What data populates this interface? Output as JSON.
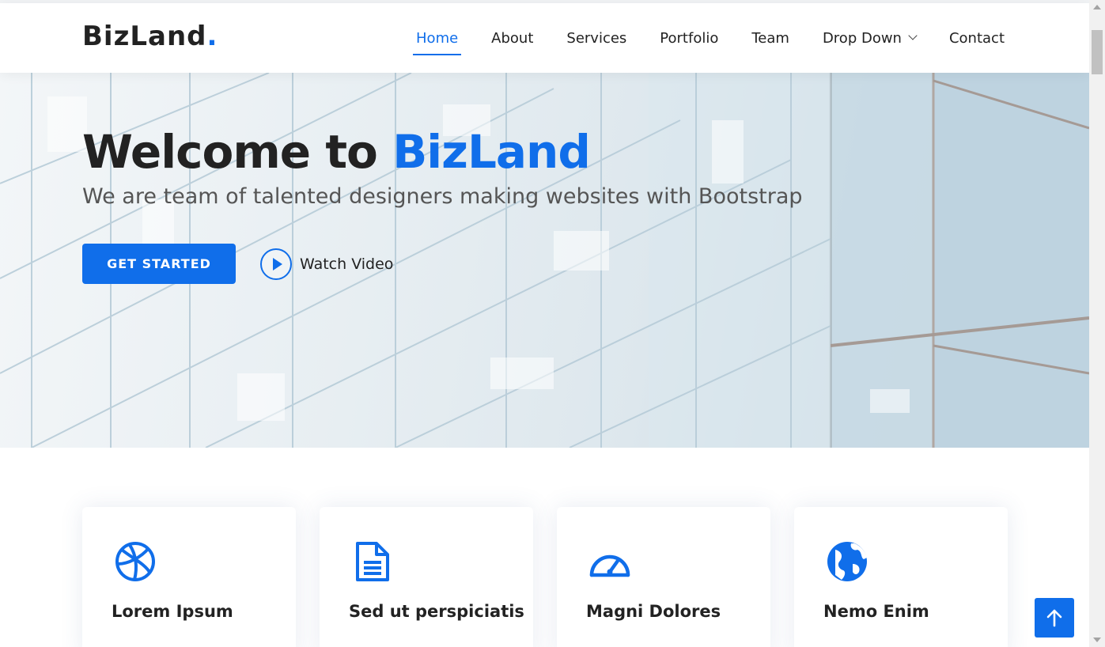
{
  "header": {
    "logo_text": "BizLand",
    "logo_dot": ".",
    "nav": [
      {
        "label": "Home",
        "active": true
      },
      {
        "label": "About"
      },
      {
        "label": "Services"
      },
      {
        "label": "Portfolio"
      },
      {
        "label": "Team"
      },
      {
        "label": "Drop Down",
        "dropdown": true
      },
      {
        "label": "Contact"
      }
    ]
  },
  "hero": {
    "title_prefix": "Welcome to",
    "title_brand": "BizLand",
    "subtitle": "We are team of talented designers making websites with Bootstrap",
    "cta_label": "GET STARTED",
    "watch_label": "Watch Video"
  },
  "services": [
    {
      "icon": "dribbble-icon",
      "title": "Lorem Ipsum"
    },
    {
      "icon": "document-icon",
      "title": "Sed ut perspiciatis"
    },
    {
      "icon": "speedometer-icon",
      "title": "Magni Dolores"
    },
    {
      "icon": "globe-icon",
      "title": "Nemo Enim"
    }
  ],
  "colors": {
    "accent": "#106eea",
    "text": "#222222",
    "muted": "#555555"
  }
}
